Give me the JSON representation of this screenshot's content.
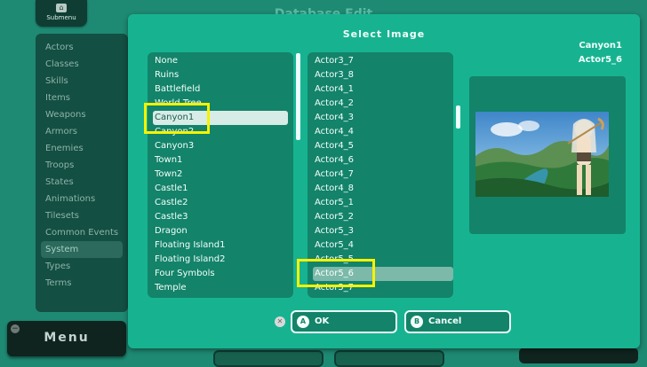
{
  "background": {
    "title": "Database Edit",
    "submenu_label": "Submenu",
    "menu_label": "Menu",
    "sidebar": [
      "Actors",
      "Classes",
      "Skills",
      "Items",
      "Weapons",
      "Armors",
      "Enemies",
      "Troops",
      "States",
      "Animations",
      "Tilesets",
      "Common Events",
      "System",
      "Types",
      "Terms"
    ],
    "sidebar_selected": "System"
  },
  "dialog": {
    "title": "Select Image",
    "selected_folder": "Canyon1",
    "selected_file": "Actor5_6",
    "folders": [
      "None",
      "Ruins",
      "Battlefield",
      "World Tree",
      "Canyon1",
      "Canyon2",
      "Canyon3",
      "Town1",
      "Town2",
      "Castle1",
      "Castle2",
      "Castle3",
      "Dragon",
      "Floating Island1",
      "Floating Island2",
      "Four Symbols",
      "Temple"
    ],
    "files": [
      "Actor3_7",
      "Actor3_8",
      "Actor4_1",
      "Actor4_2",
      "Actor4_3",
      "Actor4_4",
      "Actor4_5",
      "Actor4_6",
      "Actor4_7",
      "Actor4_8",
      "Actor5_1",
      "Actor5_2",
      "Actor5_3",
      "Actor5_4",
      "Actor5_5",
      "Actor5_6",
      "Actor5_7"
    ],
    "ok_label": "OK",
    "ok_badge": "A",
    "cancel_label": "Cancel",
    "cancel_badge": "B",
    "x_badge": "✕",
    "highlight_color": "#f7f200"
  },
  "icons": {
    "submenu": "controller-button-icon",
    "menu": "minus-button-icon"
  }
}
